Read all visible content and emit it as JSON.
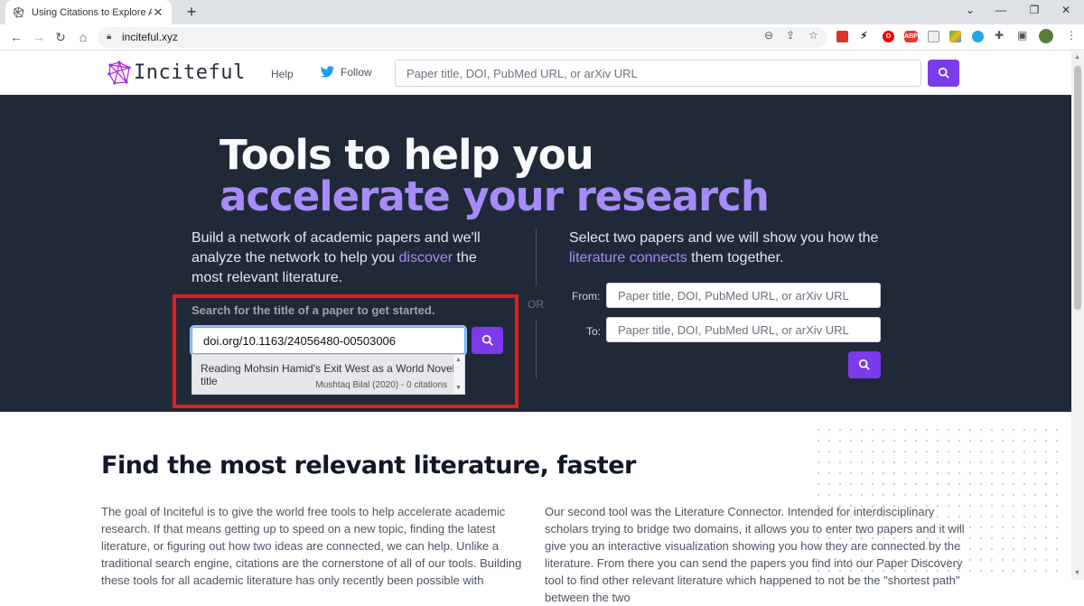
{
  "browser": {
    "tab_title": "Using Citations to Explore Acade",
    "url": "inciteful.xyz",
    "extensions": {
      "abp": "ABP"
    }
  },
  "header": {
    "logo_text": "Inciteful",
    "help_label": "Help",
    "follow_label": "Follow",
    "search_placeholder": "Paper title, DOI, PubMed URL, or arXiv URL"
  },
  "hero": {
    "title_line1": "Tools to help you",
    "title_line2": "accelerate your research",
    "left_desc_pre": "Build a network of academic papers and we'll analyze the network to help you ",
    "left_desc_link": "discover",
    "left_desc_post": " the most relevant literature.",
    "search_label": "Search for the title of a paper to get started.",
    "search_value": "doi.org/10.1163/24056480-00503006",
    "suggestion": {
      "title": "Reading Mohsin Hamid's Exit West as a World Novel title",
      "meta": "Mushtaq Bilal (2020) - 0 citations"
    },
    "or_label": "OR",
    "right_desc_pre": "Select two papers and we will show you how the ",
    "right_desc_link": "literature connects",
    "right_desc_post": " them together.",
    "from_label": "From:",
    "to_label": "To:",
    "from_placeholder": "Paper title, DOI, PubMed URL, or arXiv URL",
    "to_placeholder": "Paper title, DOI, PubMed URL, or arXiv URL"
  },
  "section": {
    "title": "Find the most relevant literature, faster",
    "para_left": "The goal of Inciteful is to give the world free tools to help accelerate academic research. If that means getting up to speed on a new topic, finding the latest literature, or figuring out how two ideas are connected, we can help. Unlike a traditional search engine, citations are the cornerstone of all of our tools. Building these tools for all academic literature has only recently been possible with",
    "para_right": "Our second tool was the Literature Connector. Intended for interdisciplinary scholars trying to bridge two domains, it allows you to enter two papers and it will give you an interactive visualization showing you how they are connected by the literature. From there you can send the papers you find into our Paper Discovery tool to find other relevant literature which happened to not be the \"shortest path\" between the two"
  },
  "colors": {
    "accent": "#7c3aed",
    "accent_light": "#a78bfa",
    "hero_bg": "#1f2937",
    "highlight": "#e11d1d"
  }
}
